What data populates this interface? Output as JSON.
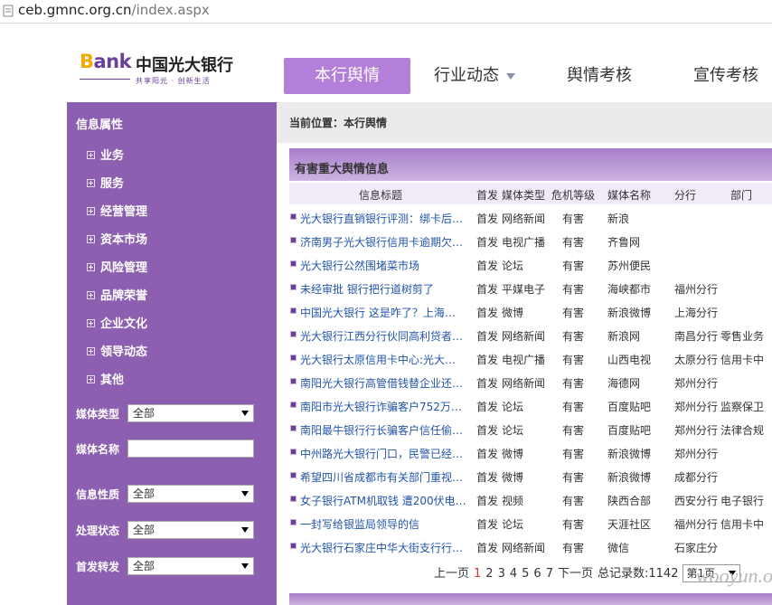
{
  "browser": {
    "url_host": "ceb.gmnc.org.cn",
    "url_path": "/index.aspx"
  },
  "header": {
    "logo": {
      "bank_text": "ank",
      "bank_first": "B",
      "name": "中国光大银行",
      "slogan": "共享阳光 · 创新生活"
    },
    "nav": [
      {
        "label": "本行舆情",
        "active": true
      },
      {
        "label": "行业动态",
        "has_dropdown": true
      },
      {
        "label": "舆情考核"
      },
      {
        "label": "宣传考核"
      }
    ]
  },
  "sidebar": {
    "title": "信息属性",
    "items": [
      "业务",
      "服务",
      "经营管理",
      "资本市场",
      "风险管理",
      "品牌荣誉",
      "企业文化",
      "领导动态",
      "其他"
    ],
    "filters": {
      "media_type": {
        "label": "媒体类型",
        "value": "全部"
      },
      "media_name": {
        "label": "媒体名称",
        "value": ""
      },
      "info_nature": {
        "label": "信息性质",
        "value": "全部"
      },
      "status": {
        "label": "处理状态",
        "value": "全部"
      },
      "first_post": {
        "label": "首发转发",
        "value": "全部"
      }
    }
  },
  "breadcrumb": "当前位置：本行舆情",
  "panel": {
    "title": "有害重大舆情信息",
    "columns": [
      "信息标题",
      "首发",
      "媒体类型",
      "危机等级",
      "媒体名称",
      "分行",
      "部门"
    ],
    "rows": [
      [
        "光大银行直销银行评测：绑卡后…",
        "首发",
        "网络新闻",
        "有害",
        "新浪",
        "",
        ""
      ],
      [
        "济南男子光大银行信用卡逾期欠…",
        "首发",
        "电视广播",
        "有害",
        "齐鲁网",
        "",
        ""
      ],
      [
        "光大银行公然围堵菜市场",
        "首发",
        "论坛",
        "有害",
        "苏州便民",
        "",
        ""
      ],
      [
        "未经审批 银行把行道树剪了",
        "首发",
        "平媒电子",
        "有害",
        "海峡都市",
        "福州分行",
        ""
      ],
      [
        "中国光大银行 这是咋了？上海…",
        "首发",
        "微博",
        "有害",
        "新浪微博",
        "上海分行",
        ""
      ],
      [
        "光大银行江西分行伙同高利贷者…",
        "首发",
        "网络新闻",
        "有害",
        "新浪网",
        "南昌分行",
        "零售业务"
      ],
      [
        "光大银行太原信用卡中心:光大…",
        "首发",
        "电视广播",
        "有害",
        "山西电视",
        "太原分行",
        "信用卡中"
      ],
      [
        "南阳光大银行高管借钱替企业还…",
        "首发",
        "网络新闻",
        "有害",
        "海德网",
        "郑州分行",
        ""
      ],
      [
        "南阳市光大银行诈骗客户752万…",
        "首发",
        "论坛",
        "有害",
        "百度贴吧",
        "郑州分行",
        "监察保卫"
      ],
      [
        "南阳最牛银行行长骗客户信任偷…",
        "首发",
        "论坛",
        "有害",
        "百度贴吧",
        "郑州分行",
        "法律合规"
      ],
      [
        "中州路光大银行门口，民警已经…",
        "首发",
        "微博",
        "有害",
        "新浪微博",
        "郑州分行",
        ""
      ],
      [
        "希望四川省成都市有关部门重视…",
        "首发",
        "微博",
        "有害",
        "新浪微博",
        "成都分行",
        ""
      ],
      [
        "女子银行ATM机取钱 遭200伏电…",
        "首发",
        "视频",
        "有害",
        "陕西合部",
        "西安分行",
        "电子银行"
      ],
      [
        "一封写给银监局领导的信",
        "首发",
        "论坛",
        "有害",
        "天涯社区",
        "福州分行",
        "信用卡中"
      ],
      [
        "光大银行石家庄中华大街支行行…",
        "首发",
        "网络新闻",
        "有害",
        "微信",
        "石家庄分",
        ""
      ]
    ]
  },
  "pager": {
    "prev": "上一页",
    "pages": [
      "1",
      "2",
      "3",
      "4",
      "5",
      "6",
      "7"
    ],
    "current": "1",
    "next": "下一页",
    "total": "总记录数:1142",
    "page_select": "第1页"
  },
  "watermark": "wooyun.org"
}
